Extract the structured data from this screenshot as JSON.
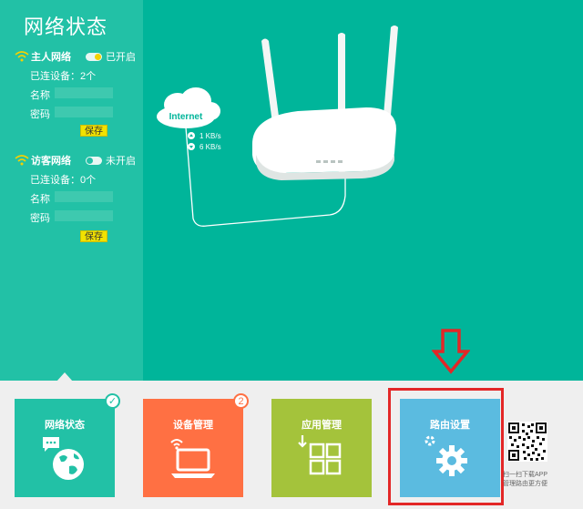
{
  "page": {
    "title": "网络状态"
  },
  "main_network": {
    "label": "主人网络",
    "status": "已开启",
    "connected": "已连设备：2个",
    "name_label": "名称",
    "password_label": "密码",
    "save_label": "保存"
  },
  "guest_network": {
    "label": "访客网络",
    "status": "未开启",
    "connected": "已连设备：0个",
    "name_label": "名称",
    "password_label": "密码",
    "save_label": "保存"
  },
  "illustration": {
    "cloud_label": "Internet",
    "upload_speed": "1 KB/s",
    "download_speed": "6 KB/s"
  },
  "nav": {
    "tiles": [
      {
        "label": "网络状态",
        "icon": "globe-chat-icon",
        "badge": "✓"
      },
      {
        "label": "设备管理",
        "icon": "laptop-wifi-icon",
        "badge": "2"
      },
      {
        "label": "应用管理",
        "icon": "app-grid-icon"
      },
      {
        "label": "路由设置",
        "icon": "gear-icon"
      }
    ]
  },
  "qr": {
    "caption_line1": "扫一扫下载APP",
    "caption_line2": "管理路由更方便"
  },
  "colors": {
    "main_bg": "#00b59a",
    "panel_bg": "#22c1a6",
    "tile_network": "#22c1a6",
    "tile_device": "#ff7043",
    "tile_app": "#a4c33b",
    "tile_router": "#5bbbe0",
    "highlight": "#e32727",
    "save_button": "#f2e200"
  }
}
